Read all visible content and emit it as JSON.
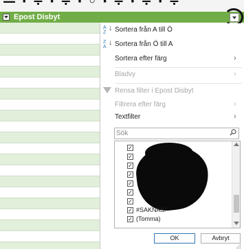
{
  "banner": {
    "text": "— · ÷ · ÷ · ◦ · ÷ · ÷ · ÷"
  },
  "sheet": {
    "header_label": "Epost Disbyt",
    "header_color": "#70ad47",
    "band_color": "#e2efda"
  },
  "dropdown": {
    "sort_asc": "Sortera från A till Ö",
    "sort_desc": "Sortera från Ö till A",
    "sort_by_color": "Sortera efter färg",
    "sheet_view": "Bladvy",
    "clear_filter": "Rensa filter i Epost Disbyt",
    "filter_by_color": "Filtrera efter färg",
    "text_filter": "Textfilter",
    "search_placeholder": "Sök",
    "list_items": [
      {
        "label": "#SAKNAS!",
        "checked": true
      },
      {
        "label": "(Tomma)",
        "checked": true
      }
    ],
    "ok": "OK",
    "cancel": "Avbryt"
  },
  "colors": {
    "accent": "#2e75b6",
    "disabled_text": "#a6a6a6"
  }
}
